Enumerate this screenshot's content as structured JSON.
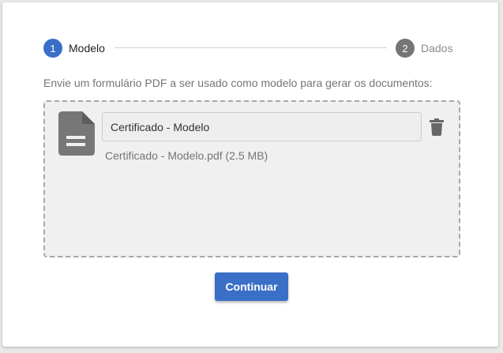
{
  "colors": {
    "primary": "#3a6fc7",
    "inactive_step": "#757575",
    "file_icon": "#777777"
  },
  "stepper": {
    "steps": [
      {
        "number": "1",
        "label": "Modelo",
        "active": true
      },
      {
        "number": "2",
        "label": "Dados",
        "active": false
      }
    ]
  },
  "instructions": "Envie um formulário PDF a ser usado como modelo para gerar os documentos:",
  "upload": {
    "file_icon": "file-document-icon",
    "name_value": "Certificado - Modelo",
    "file_info": "Certificado - Modelo.pdf (2.5 MB)",
    "delete_icon": "trash-icon"
  },
  "actions": {
    "continue_label": "Continuar"
  }
}
